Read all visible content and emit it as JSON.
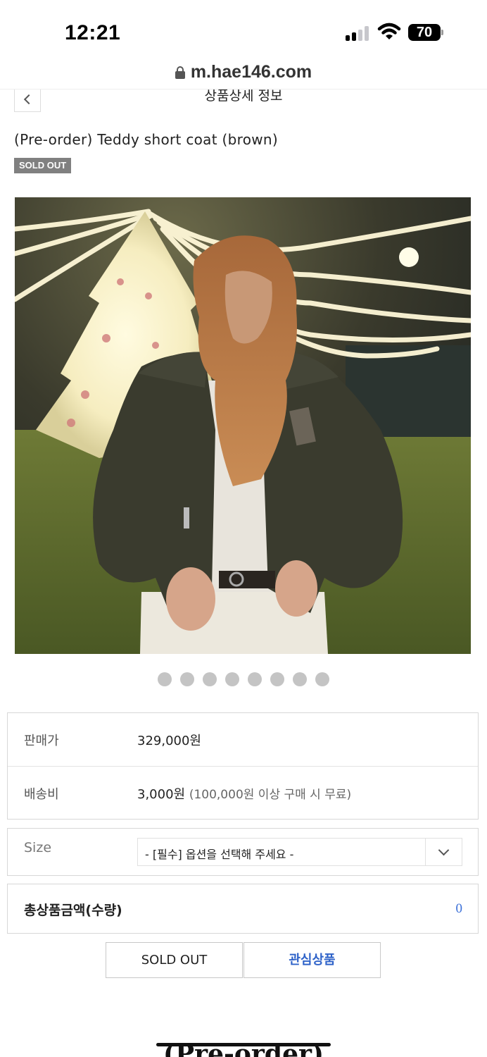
{
  "status_bar": {
    "time": "12:21",
    "battery": "70",
    "icons": [
      "cellular-signal-icon",
      "wifi-icon",
      "battery-icon"
    ]
  },
  "browser": {
    "url": "m.hae146.com",
    "icons": [
      "lock-icon"
    ]
  },
  "header": {
    "title": "상품상세 정보",
    "back_icon": "chevron-left-icon"
  },
  "product": {
    "name": "(Pre-order) Teddy short coat (brown)",
    "badge": "SOLD OUT",
    "image_description_icon": "product-photo",
    "slides_total": 8,
    "slide_active": 1
  },
  "info": {
    "price_label": "판매가",
    "price_value": "329,000원",
    "shipping_label": "배송비",
    "shipping_value": "3,000원",
    "shipping_note": "(100,000원 이상 구매 시 무료)"
  },
  "option": {
    "label": "Size",
    "selected": "- [필수] 옵션을 선택해 주세요 -",
    "icon": "chevron-down-icon"
  },
  "total": {
    "label": "총상품금액(수량)",
    "value": "0"
  },
  "actions": {
    "soldout_label": "SOLD OUT",
    "wishlist_label": "관심상품"
  },
  "detail": {
    "heading": "(Pre-order)"
  },
  "colors": {
    "badge_bg": "#808080",
    "link_blue": "#2f63c9",
    "total_blue": "#3a6fd8"
  }
}
